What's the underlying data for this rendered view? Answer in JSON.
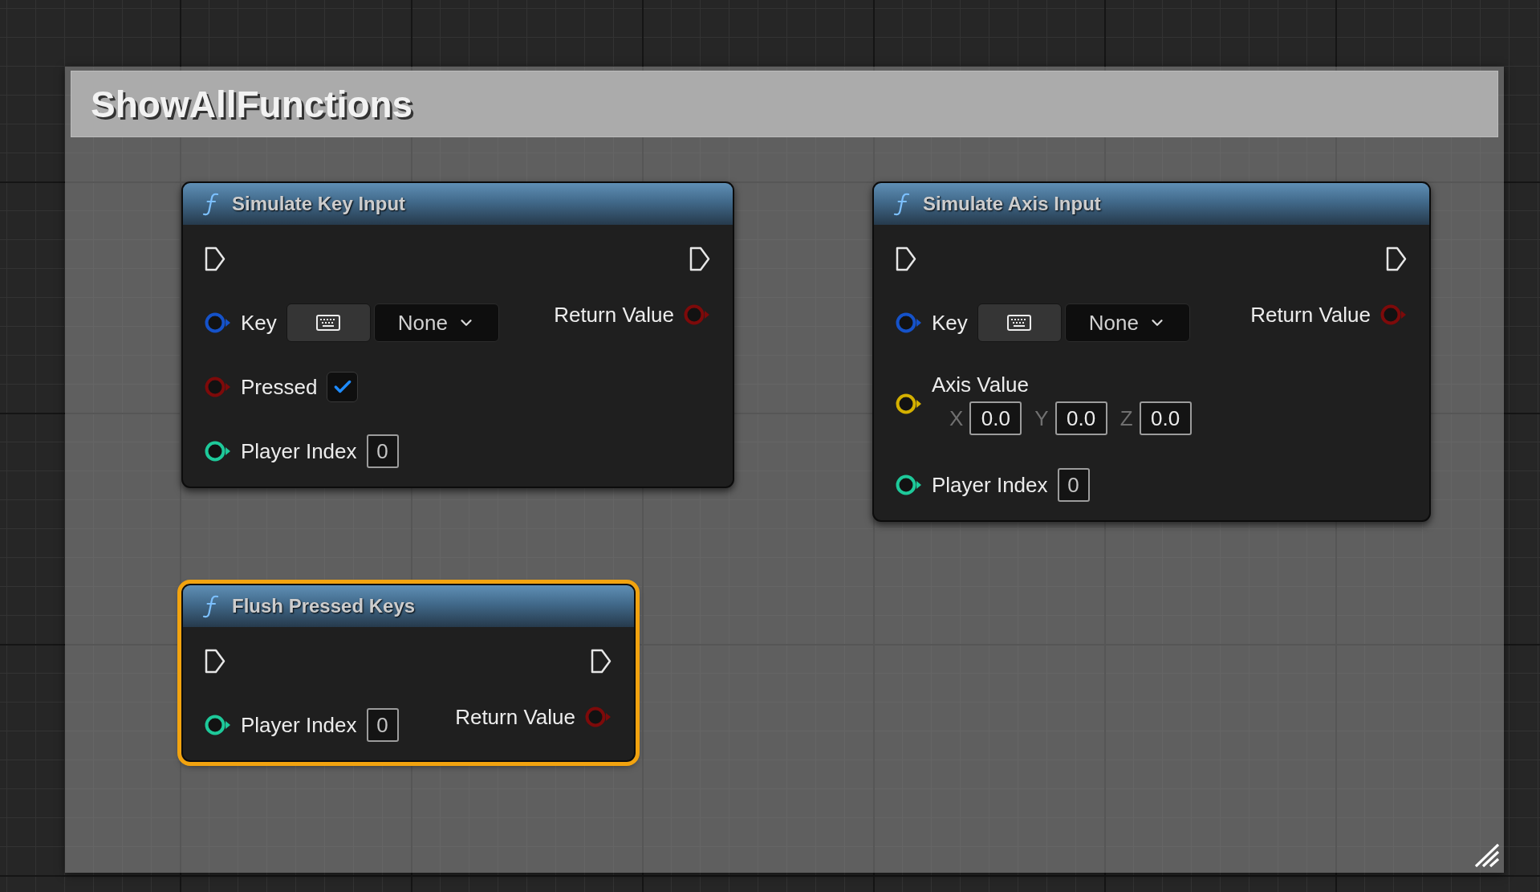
{
  "comment": {
    "title": "ShowAllFunctions"
  },
  "nodes": [
    {
      "title": "Simulate Key Input",
      "selected": false,
      "inputs": [
        {
          "kind": "key",
          "label": "Key",
          "color": "#1552c9",
          "value": "None"
        },
        {
          "kind": "bool",
          "label": "Pressed",
          "color": "#7d0a0a",
          "checked": true
        },
        {
          "kind": "number",
          "label": "Player Index",
          "color": "#1ec99a",
          "value": "0"
        }
      ],
      "outputs": [
        {
          "label": "Return Value",
          "color": "#7d0a0a"
        }
      ]
    },
    {
      "title": "Simulate Axis Input",
      "selected": false,
      "inputs": [
        {
          "kind": "key",
          "label": "Key",
          "color": "#1552c9",
          "value": "None"
        },
        {
          "kind": "vector",
          "label": "Axis Value",
          "color": "#d4b000",
          "components": [
            {
              "axis": "X",
              "value": "0.0"
            },
            {
              "axis": "Y",
              "value": "0.0"
            },
            {
              "axis": "Z",
              "value": "0.0"
            }
          ]
        },
        {
          "kind": "number",
          "label": "Player Index",
          "color": "#1ec99a",
          "value": "0"
        }
      ],
      "outputs": [
        {
          "label": "Return Value",
          "color": "#7d0a0a"
        }
      ]
    },
    {
      "title": "Flush Pressed Keys",
      "selected": true,
      "inputs": [
        {
          "kind": "number",
          "label": "Player Index",
          "color": "#1ec99a",
          "value": "0"
        }
      ],
      "outputs": [
        {
          "label": "Return Value",
          "color": "#7d0a0a"
        }
      ]
    }
  ]
}
